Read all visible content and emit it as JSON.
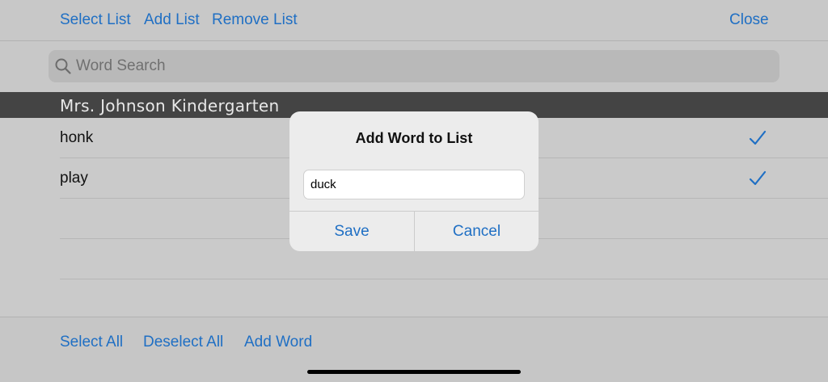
{
  "toolbar": {
    "select_list": "Select List",
    "add_list": "Add List",
    "remove_list": "Remove List",
    "close": "Close"
  },
  "search": {
    "placeholder": "Word Search",
    "icon": "search-icon"
  },
  "list": {
    "title": "Mrs. Johnson Kindergarten",
    "items": [
      {
        "label": "honk",
        "checked": true
      },
      {
        "label": "play",
        "checked": true
      }
    ]
  },
  "bottom_toolbar": {
    "select_all": "Select All",
    "deselect_all": "Deselect All",
    "add_word": "Add Word"
  },
  "dialog": {
    "title": "Add Word to List",
    "input_value": "duck",
    "save": "Save",
    "cancel": "Cancel"
  },
  "colors": {
    "accent": "#1f6fc4",
    "section_header": "#444444",
    "background": "#cbcbcb"
  }
}
